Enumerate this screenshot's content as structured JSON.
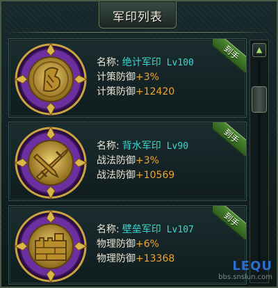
{
  "window": {
    "title": "军印列表"
  },
  "ribbon_label": "到手",
  "name_label": "名称:",
  "seals": [
    {
      "name": "绝计军印",
      "level": "Lv100",
      "icon": "scroll-seal-icon",
      "stat1_label": "计策防御",
      "stat1_value": "+3%",
      "stat2_label": "计策防御",
      "stat2_value": "+12420"
    },
    {
      "name": "背水军印",
      "level": "Lv90",
      "icon": "crossed-swords-seal-icon",
      "stat1_label": "战法防御",
      "stat1_value": "+3%",
      "stat2_label": "战法防御",
      "stat2_value": "+10569"
    },
    {
      "name": "壁垒军印",
      "level": "Lv107",
      "icon": "fortress-wall-seal-icon",
      "stat1_label": "物理防御",
      "stat1_value": "+6%",
      "stat2_label": "物理防御",
      "stat2_value": "+13368"
    }
  ],
  "scrollbar": {
    "up_icon": "triangle-up-icon"
  },
  "watermark": {
    "logo": "LEQU",
    "url": "bbs.snslun.com"
  },
  "colors": {
    "name": "#3ad8d3",
    "value": "#f2a430",
    "ribbon": "#3f7a2a",
    "emblem_purple": "#6b2fa0",
    "emblem_gold": "#c9a441"
  }
}
